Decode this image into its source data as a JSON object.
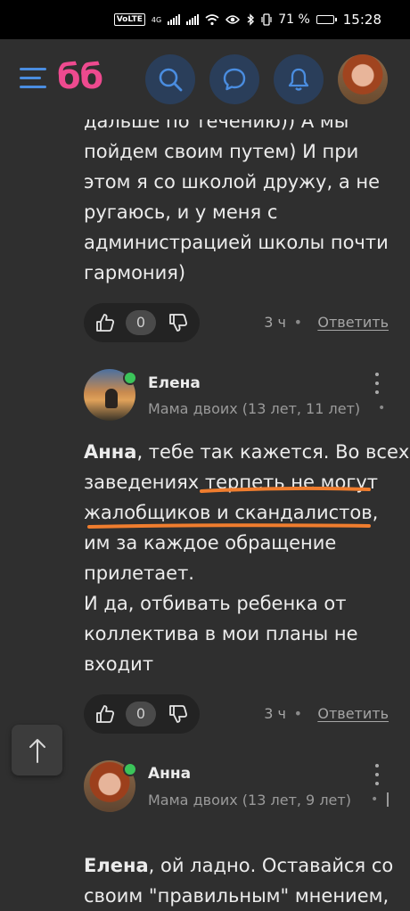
{
  "status_bar": {
    "signal_label": "4G",
    "battery": "71 %",
    "battery_level": 0.71,
    "time": "15:28"
  },
  "header": {
    "logo": "бб"
  },
  "comment1": {
    "text_lines": [
      "дальше по течению)) А мы",
      "пойдем своим путем) И при",
      "этом я со школой дружу, а не",
      "ругаюсь, и у меня с",
      "администрацией школы почти",
      "гармония)"
    ],
    "likes": "0",
    "time": "3 ч",
    "reply": "Ответить"
  },
  "comment2": {
    "author": "Елена",
    "meta": "Мама двоих (13 лет, 11 лет)",
    "mention": "Анна",
    "line1_rest": ", тебе так кажется. Во всех",
    "text_lines": [
      "заведениях терпеть не могут",
      "жалобщиков и скандалистов,",
      "им за каждое обращение",
      "прилетает.",
      "И да, отбивать ребенка от",
      "коллектива в мои планы не",
      "входит"
    ],
    "likes": "0",
    "time": "3 ч",
    "reply": "Ответить"
  },
  "comment3": {
    "author": "Анна",
    "meta": "Мама двоих (13 лет, 9 лет)",
    "mention": "Елена",
    "line1_rest": ", ой ладно. Оставайся со",
    "text_lines": [
      "своим \"правильным\" мнением,"
    ]
  },
  "colors": {
    "accent": "#4a8de0",
    "logo": "#ee4a8f",
    "highlight": "#f07d2e",
    "online": "#3bc45a"
  }
}
